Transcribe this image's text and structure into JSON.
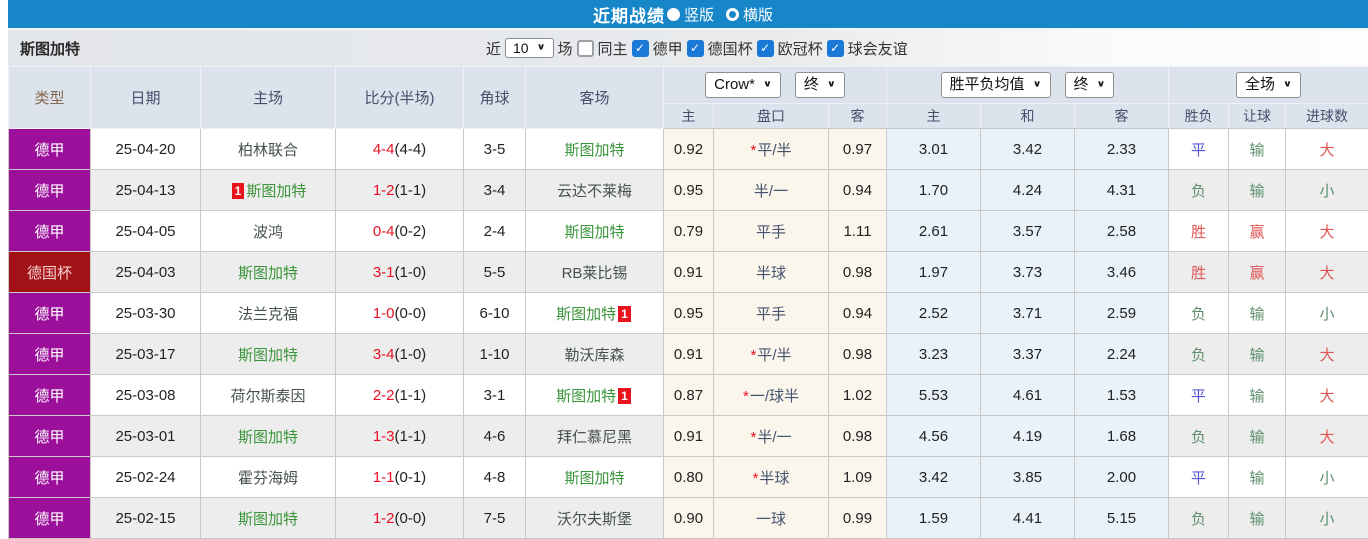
{
  "topbar": {
    "title": "近期战绩",
    "vertical": "竖版",
    "horizontal": "横版"
  },
  "filter": {
    "team": "斯图加特",
    "near": "近",
    "count": "10",
    "games": "场",
    "same_home": "同主",
    "leagues": [
      "德甲",
      "德国杯",
      "欧冠杯",
      "球会友谊"
    ]
  },
  "header": {
    "cols": [
      "类型",
      "日期",
      "主场",
      "比分(半场)",
      "角球",
      "客场"
    ],
    "selects": {
      "odds_source": "Crow*",
      "final_a": "终",
      "avg_label": "胜平负均值",
      "final_b": "终",
      "scope": "全场"
    },
    "sub": [
      "主",
      "盘口",
      "客",
      "主",
      "和",
      "客",
      "胜负",
      "让球",
      "进球数"
    ]
  },
  "colors": {
    "topbar_blue": "#1686c8",
    "league_purple": "#9b0f9b",
    "cup_red": "#a21217",
    "self_team_green": "#3a943a",
    "score_red": "#e81123",
    "win_red": "#e25555",
    "draw_blue": "#5555d8",
    "lose_green": "#5d8f6d",
    "crown_bg": "#fbf6ec",
    "avg_bg": "#e9f2f9",
    "checkbox_blue": "#1a78d6"
  },
  "rows": [
    {
      "league": "德甲",
      "cup": false,
      "date": "25-04-20",
      "home": {
        "name": "柏林联合",
        "self": false,
        "badge": ""
      },
      "score": "4-4",
      "half": "(4-4)",
      "corner": "3-5",
      "away": {
        "name": "斯图加特",
        "self": true,
        "badge": ""
      },
      "crown": {
        "home": "0.92",
        "star": true,
        "handicap": "平/半",
        "away": "0.97"
      },
      "avg": {
        "win": "3.01",
        "draw": "3.42",
        "lose": "2.33"
      },
      "res": {
        "outcome": "平",
        "outcome_c": "b",
        "handicap": "输",
        "handicap_c": "g",
        "goals": "大",
        "goals_c": "r"
      }
    },
    {
      "league": "德甲",
      "cup": false,
      "date": "25-04-13",
      "home": {
        "name": "斯图加特",
        "self": true,
        "badge": "1",
        "badge_pos": "before"
      },
      "score": "1-2",
      "half": "(1-1)",
      "corner": "3-4",
      "away": {
        "name": "云达不莱梅",
        "self": false,
        "badge": ""
      },
      "crown": {
        "home": "0.95",
        "star": false,
        "handicap": "半/一",
        "away": "0.94"
      },
      "avg": {
        "win": "1.70",
        "draw": "4.24",
        "lose": "4.31"
      },
      "res": {
        "outcome": "负",
        "outcome_c": "g",
        "handicap": "输",
        "handicap_c": "g",
        "goals": "小",
        "goals_c": "g"
      }
    },
    {
      "league": "德甲",
      "cup": false,
      "date": "25-04-05",
      "home": {
        "name": "波鸿",
        "self": false,
        "badge": ""
      },
      "score": "0-4",
      "half": "(0-2)",
      "corner": "2-4",
      "away": {
        "name": "斯图加特",
        "self": true,
        "badge": ""
      },
      "crown": {
        "home": "0.79",
        "star": false,
        "handicap": "平手",
        "away": "1.11"
      },
      "avg": {
        "win": "2.61",
        "draw": "3.57",
        "lose": "2.58"
      },
      "res": {
        "outcome": "胜",
        "outcome_c": "r",
        "handicap": "赢",
        "handicap_c": "r",
        "goals": "大",
        "goals_c": "r"
      }
    },
    {
      "league": "德国杯",
      "cup": true,
      "date": "25-04-03",
      "home": {
        "name": "斯图加特",
        "self": true,
        "badge": ""
      },
      "score": "3-1",
      "half": "(1-0)",
      "corner": "5-5",
      "away": {
        "name": "RB莱比锡",
        "self": false,
        "badge": ""
      },
      "crown": {
        "home": "0.91",
        "star": false,
        "handicap": "半球",
        "away": "0.98"
      },
      "avg": {
        "win": "1.97",
        "draw": "3.73",
        "lose": "3.46"
      },
      "res": {
        "outcome": "胜",
        "outcome_c": "r",
        "handicap": "赢",
        "handicap_c": "r",
        "goals": "大",
        "goals_c": "r"
      }
    },
    {
      "league": "德甲",
      "cup": false,
      "date": "25-03-30",
      "home": {
        "name": "法兰克福",
        "self": false,
        "badge": ""
      },
      "score": "1-0",
      "half": "(0-0)",
      "corner": "6-10",
      "away": {
        "name": "斯图加特",
        "self": true,
        "badge": "1",
        "badge_pos": "after"
      },
      "crown": {
        "home": "0.95",
        "star": false,
        "handicap": "平手",
        "away": "0.94"
      },
      "avg": {
        "win": "2.52",
        "draw": "3.71",
        "lose": "2.59"
      },
      "res": {
        "outcome": "负",
        "outcome_c": "g",
        "handicap": "输",
        "handicap_c": "g",
        "goals": "小",
        "goals_c": "g"
      }
    },
    {
      "league": "德甲",
      "cup": false,
      "date": "25-03-17",
      "home": {
        "name": "斯图加特",
        "self": true,
        "badge": ""
      },
      "score": "3-4",
      "half": "(1-0)",
      "corner": "1-10",
      "away": {
        "name": "勒沃库森",
        "self": false,
        "badge": ""
      },
      "crown": {
        "home": "0.91",
        "star": true,
        "handicap": "平/半",
        "away": "0.98"
      },
      "avg": {
        "win": "3.23",
        "draw": "3.37",
        "lose": "2.24"
      },
      "res": {
        "outcome": "负",
        "outcome_c": "g",
        "handicap": "输",
        "handicap_c": "g",
        "goals": "大",
        "goals_c": "r"
      }
    },
    {
      "league": "德甲",
      "cup": false,
      "date": "25-03-08",
      "home": {
        "name": "荷尔斯泰因",
        "self": false,
        "badge": ""
      },
      "score": "2-2",
      "half": "(1-1)",
      "corner": "3-1",
      "away": {
        "name": "斯图加特",
        "self": true,
        "badge": "1",
        "badge_pos": "after"
      },
      "crown": {
        "home": "0.87",
        "star": true,
        "handicap": "一/球半",
        "away": "1.02"
      },
      "avg": {
        "win": "5.53",
        "draw": "4.61",
        "lose": "1.53"
      },
      "res": {
        "outcome": "平",
        "outcome_c": "b",
        "handicap": "输",
        "handicap_c": "g",
        "goals": "大",
        "goals_c": "r"
      }
    },
    {
      "league": "德甲",
      "cup": false,
      "date": "25-03-01",
      "home": {
        "name": "斯图加特",
        "self": true,
        "badge": ""
      },
      "score": "1-3",
      "half": "(1-1)",
      "corner": "4-6",
      "away": {
        "name": "拜仁慕尼黑",
        "self": false,
        "badge": ""
      },
      "crown": {
        "home": "0.91",
        "star": true,
        "handicap": "半/一",
        "away": "0.98"
      },
      "avg": {
        "win": "4.56",
        "draw": "4.19",
        "lose": "1.68"
      },
      "res": {
        "outcome": "负",
        "outcome_c": "g",
        "handicap": "输",
        "handicap_c": "g",
        "goals": "大",
        "goals_c": "r"
      }
    },
    {
      "league": "德甲",
      "cup": false,
      "date": "25-02-24",
      "home": {
        "name": "霍芬海姆",
        "self": false,
        "badge": ""
      },
      "score": "1-1",
      "half": "(0-1)",
      "corner": "4-8",
      "away": {
        "name": "斯图加特",
        "self": true,
        "badge": ""
      },
      "crown": {
        "home": "0.80",
        "star": true,
        "handicap": "半球",
        "away": "1.09"
      },
      "avg": {
        "win": "3.42",
        "draw": "3.85",
        "lose": "2.00"
      },
      "res": {
        "outcome": "平",
        "outcome_c": "b",
        "handicap": "输",
        "handicap_c": "g",
        "goals": "小",
        "goals_c": "g"
      }
    },
    {
      "league": "德甲",
      "cup": false,
      "date": "25-02-15",
      "home": {
        "name": "斯图加特",
        "self": true,
        "badge": ""
      },
      "score": "1-2",
      "half": "(0-0)",
      "corner": "7-5",
      "away": {
        "name": "沃尔夫斯堡",
        "self": false,
        "badge": ""
      },
      "crown": {
        "home": "0.90",
        "star": false,
        "handicap": "一球",
        "away": "0.99"
      },
      "avg": {
        "win": "1.59",
        "draw": "4.41",
        "lose": "5.15"
      },
      "res": {
        "outcome": "负",
        "outcome_c": "g",
        "handicap": "输",
        "handicap_c": "g",
        "goals": "小",
        "goals_c": "g"
      }
    }
  ]
}
